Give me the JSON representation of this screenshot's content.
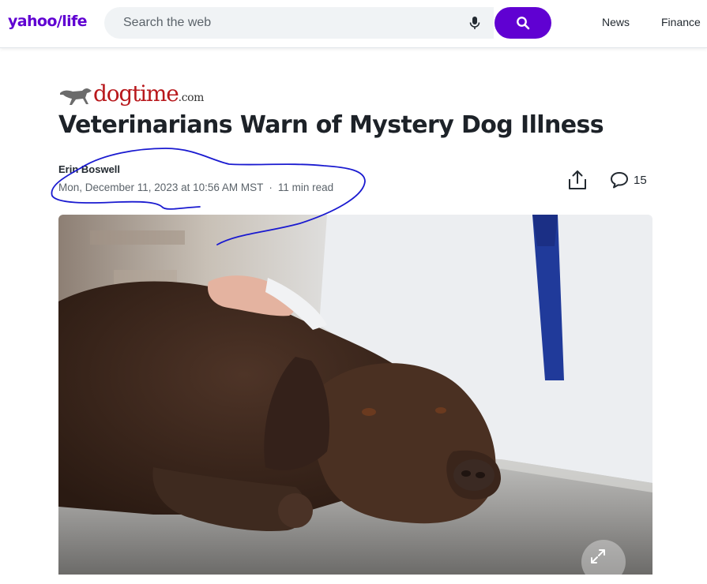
{
  "header": {
    "logo_main": "yahoo",
    "logo_slash": "/",
    "logo_sub": "life",
    "search_placeholder": "Search the web",
    "nav": [
      "News",
      "Finance"
    ]
  },
  "article": {
    "source_brand": "dogtime",
    "source_suffix": ".com",
    "title": "Veterinarians Warn of Mystery Dog Illness",
    "author": "Erin Boswell",
    "date": "Mon, December 11, 2023 at 10:56 AM MST",
    "separator": "·",
    "read_time": "11 min read",
    "comments_count": "15"
  },
  "icons": {
    "mic": "microphone-icon",
    "search": "search-icon",
    "share": "share-icon",
    "comments": "comment-icon",
    "expand": "expand-icon"
  },
  "colors": {
    "brand_purple": "#6001d2",
    "annotation_ink": "#1a1ad0",
    "dogtime_red": "#b8181c"
  }
}
